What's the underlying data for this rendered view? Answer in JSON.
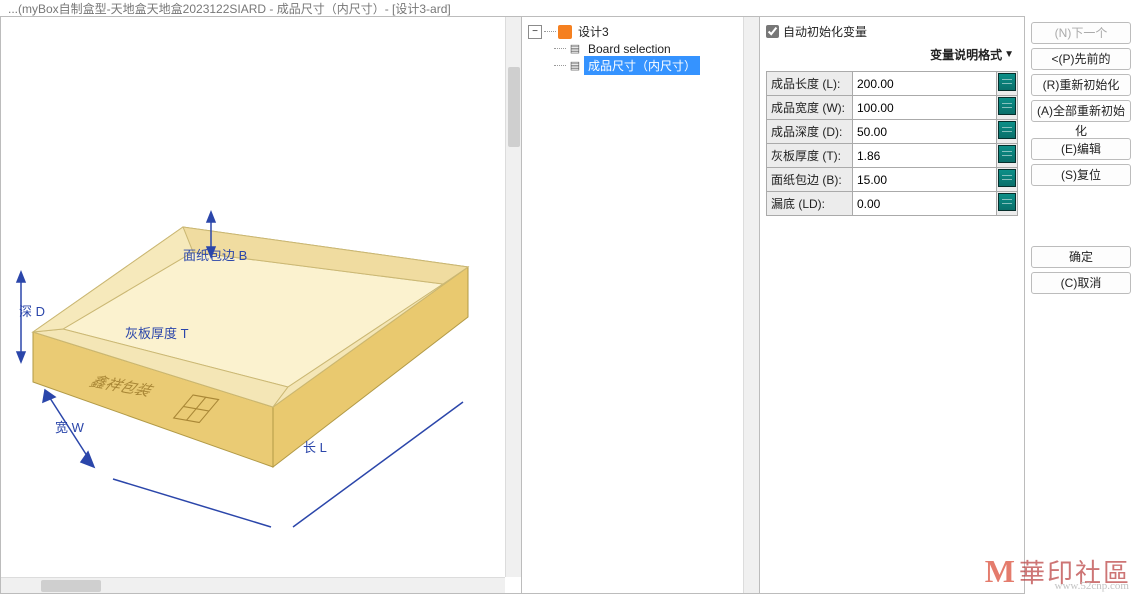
{
  "titlebar": "...(myBox自制盒型-天地盒天地盒2023122SIARD - 成品尺寸（内尺寸）- [设计3-ard]",
  "tree": {
    "root": "设计3",
    "items": [
      "Board selection",
      "成品尺寸（内尺寸）"
    ],
    "selected_index": 1
  },
  "auto_init": {
    "label": "自动初始化变量",
    "checked": true
  },
  "format_button": "变量说明格式",
  "params": [
    {
      "label": "成品长度 (L):",
      "value": "200.00"
    },
    {
      "label": "成品宽度 (W):",
      "value": "100.00"
    },
    {
      "label": "成品深度 (D):",
      "value": "50.00"
    },
    {
      "label": "灰板厚度 (T):",
      "value": "1.86"
    },
    {
      "label": "面纸包边 (B):",
      "value": "15.00"
    },
    {
      "label": "漏底 (LD):",
      "value": "0.00"
    }
  ],
  "buttons": {
    "next": "(N)下一个",
    "prev": "<(P)先前的",
    "reinit": "(R)重新初始化",
    "reinit_all": "(A)全部重新初始化",
    "edit": "(E)编辑",
    "reset": "(S)复位",
    "ok": "确定",
    "cancel": "(C)取消"
  },
  "viewport_labels": {
    "wrap_b": "面纸包边 B",
    "thick_t": "灰板厚度 T",
    "depth_d": "深 D",
    "width_w": "宽 W",
    "length_l": "长 L",
    "logo": "鑫祥包装"
  },
  "watermark": {
    "brand": "華印社區",
    "url": "www.52cnp.com"
  }
}
